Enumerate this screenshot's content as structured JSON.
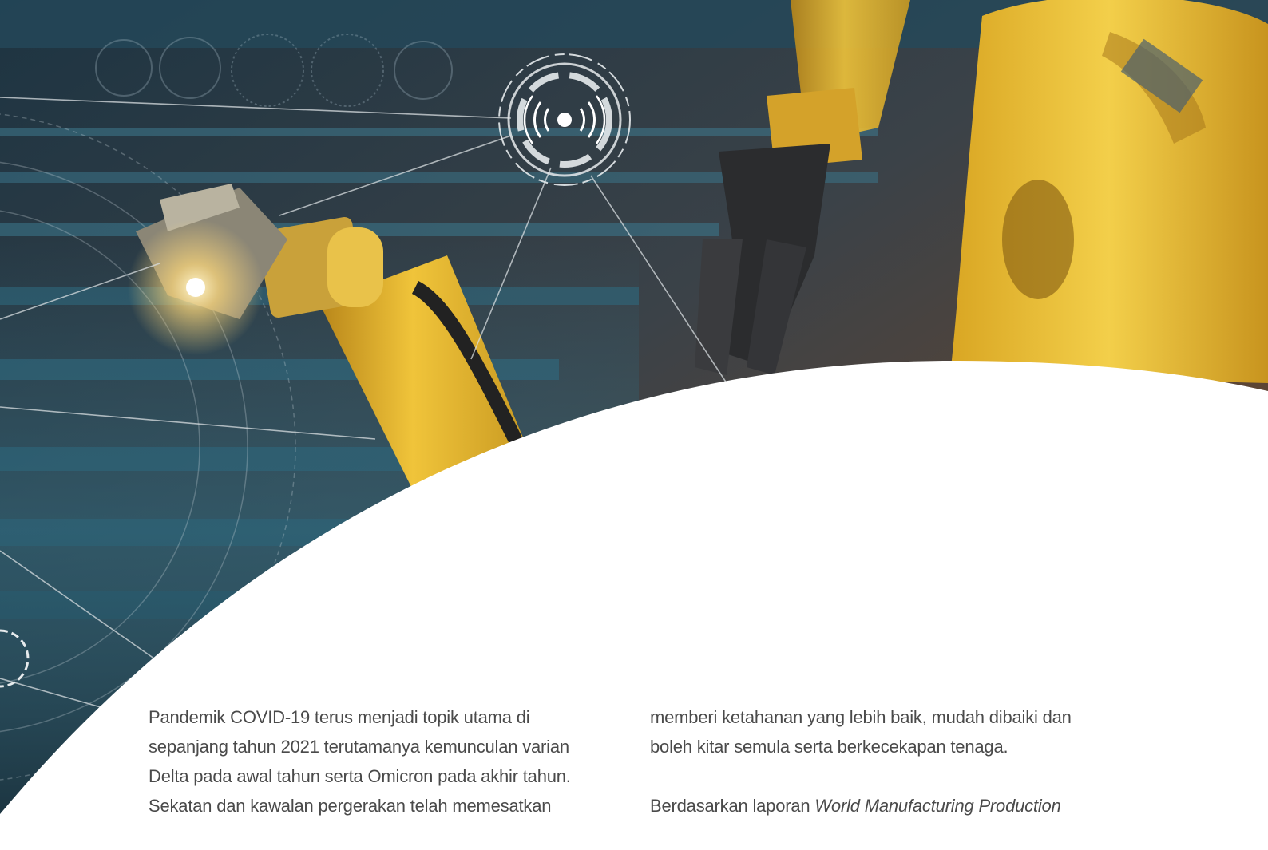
{
  "article": {
    "left_column": {
      "lines": [
        "Pandemik COVID-19 terus menjadi topik utama di",
        "sepanjang tahun 2021 terutamanya kemunculan varian",
        "Delta pada awal tahun serta Omicron pada akhir tahun.",
        "Sekatan dan kawalan pergerakan telah memesatkan"
      ]
    },
    "right_column": {
      "paragraph_1": {
        "lines": [
          "memberi ketahanan yang lebih baik, mudah dibaiki dan",
          "boleh kitar semula serta berkecekapan tenaga."
        ]
      },
      "paragraph_2": {
        "prefix": "Berdasarkan laporan ",
        "italic": "World Manufacturing Production"
      }
    }
  },
  "hero_image": {
    "subject": "industrial robotic arms with network overlay",
    "icons": [
      "wireless-signal-icon"
    ],
    "colors": {
      "robot_yellow": "#e0b12a",
      "background_dark": "#1c2f3c",
      "background_teal": "#2f6f86",
      "background_brown": "#6b4a33",
      "network_line": "#d8dde0"
    }
  }
}
